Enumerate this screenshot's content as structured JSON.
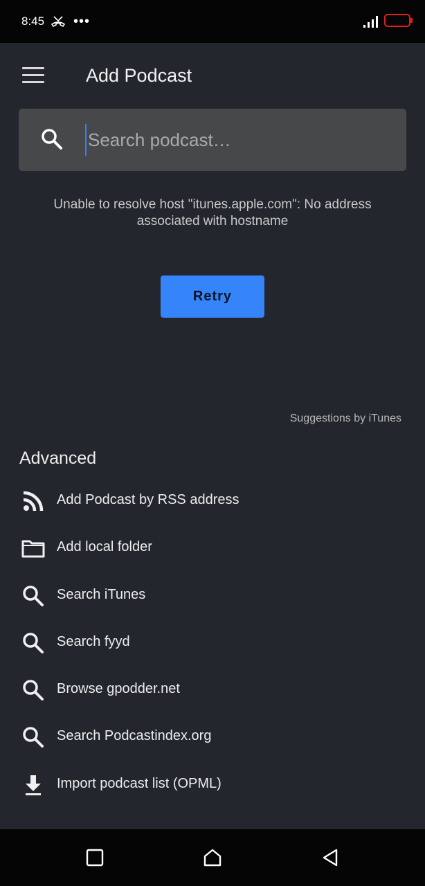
{
  "status_bar": {
    "time": "8:45",
    "icons": [
      "missed-call-icon",
      "more-dots-icon",
      "signal-icon",
      "battery-icon"
    ],
    "more": "•••"
  },
  "app_bar": {
    "title": "Add Podcast",
    "menu_icon": "hamburger-menu-icon"
  },
  "search": {
    "placeholder": "Search podcast…",
    "value": ""
  },
  "error": {
    "message": "Unable to resolve host \"itunes.apple.com\": No address associated with hostname"
  },
  "retry": {
    "label": "Retry"
  },
  "suggestions_credit": "Suggestions by iTunes",
  "advanced": {
    "header": "Advanced",
    "items": [
      {
        "icon": "rss-icon",
        "label": "Add Podcast by RSS address"
      },
      {
        "icon": "folder-icon",
        "label": "Add local folder"
      },
      {
        "icon": "search-icon",
        "label": "Search iTunes"
      },
      {
        "icon": "search-icon",
        "label": "Search fyyd"
      },
      {
        "icon": "search-icon",
        "label": "Browse gpodder.net"
      },
      {
        "icon": "search-icon",
        "label": "Search Podcastindex.org"
      },
      {
        "icon": "download-icon",
        "label": "Import podcast list (OPML)"
      }
    ]
  },
  "nav_bar": {
    "buttons": [
      "recent-apps-icon",
      "home-icon",
      "back-icon"
    ]
  },
  "colors": {
    "background": "#23272d",
    "search_box": "#464849",
    "accent": "#3584fa",
    "battery": "#e0201e"
  }
}
